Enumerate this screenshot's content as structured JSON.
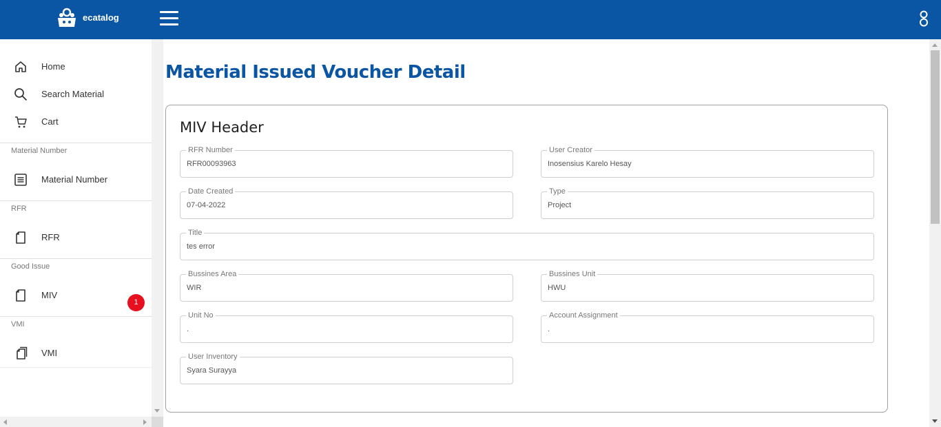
{
  "topbar": {
    "brand": "ecatalog",
    "logo_icon": "robot-logo-icon",
    "menu_icon": "hamburger-menu-icon",
    "user_icon": "user-icon",
    "background": "#0b56a4"
  },
  "sidebar": {
    "nav": [
      {
        "label": "Home",
        "icon": "home-icon"
      },
      {
        "label": "Search Material",
        "icon": "search-icon"
      },
      {
        "label": "Cart",
        "icon": "cart-icon"
      }
    ],
    "sections": [
      {
        "title": "Material Number",
        "item": {
          "label": "Material Number",
          "icon": "list-icon"
        }
      },
      {
        "title": "RFR",
        "item": {
          "label": "RFR",
          "icon": "document-icon"
        }
      },
      {
        "title": "Good Issue",
        "item": {
          "label": "MIV",
          "icon": "document-icon",
          "badge": "1"
        }
      },
      {
        "title": "VMI",
        "item": {
          "label": "VMI",
          "icon": "documents-icon"
        }
      }
    ]
  },
  "page": {
    "title": "Material Issued Voucher Detail",
    "card_title": "MIV Header",
    "fields": {
      "rfr_number": {
        "label": "RFR Number",
        "value": "RFR00093963"
      },
      "user_creator": {
        "label": "User Creator",
        "value": "Inosensius Karelo Hesay"
      },
      "date_created": {
        "label": "Date Created",
        "value": "07-04-2022"
      },
      "type": {
        "label": "Type",
        "value": "Project"
      },
      "title": {
        "label": "Title",
        "value": "tes error"
      },
      "business_area": {
        "label": "Bussines Area",
        "value": "WIR"
      },
      "business_unit": {
        "label": "Bussines Unit",
        "value": "HWU"
      },
      "unit_no": {
        "label": "Unit No",
        "value": "."
      },
      "account_assignment": {
        "label": "Account Assignment",
        "value": "."
      },
      "user_inventory": {
        "label": "User Inventory",
        "value": "Syara Surayya"
      }
    }
  },
  "colors": {
    "accent": "#0b56a4",
    "badge": "#e8101e"
  }
}
